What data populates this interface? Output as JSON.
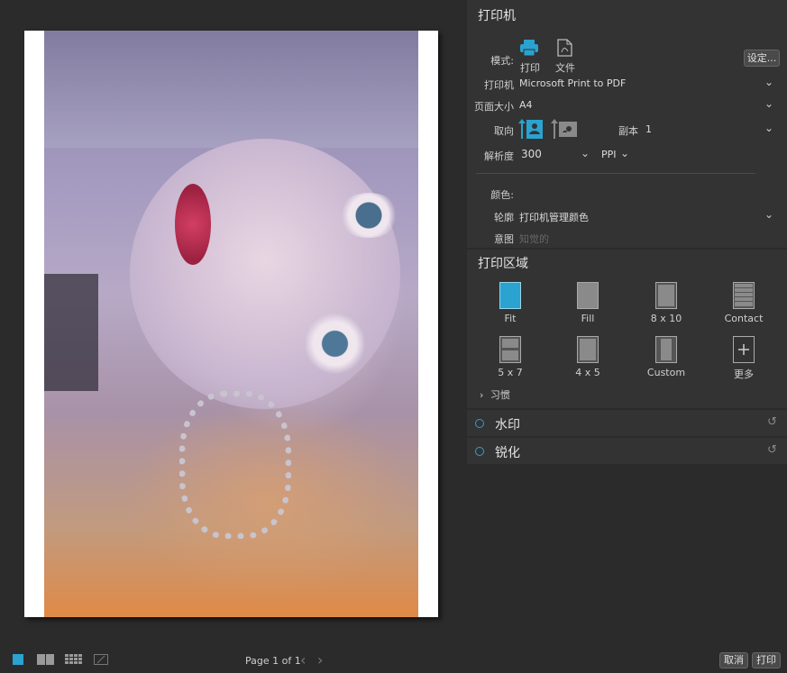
{
  "printer_section": {
    "title": "打印机",
    "mode_label": "模式:",
    "mode_print": "打印",
    "mode_file": "文件",
    "settings_button": "设定...",
    "printer_label": "打印机",
    "printer_value": "Microsoft Print to PDF",
    "page_size_label": "页面大小",
    "page_size_value": "A4",
    "orientation_label": "取向",
    "copies_label": "副本",
    "copies_value": "1",
    "resolution_label": "解析度",
    "resolution_value": "300",
    "resolution_unit": "PPI",
    "color_label": "颜色:",
    "profile_label": "轮廓",
    "profile_value": "打印机管理颜色",
    "intent_label": "意图",
    "intent_value": "知觉的"
  },
  "print_area": {
    "title": "打印区域",
    "tiles": [
      {
        "label": "Fit",
        "icon": "fit-icon"
      },
      {
        "label": "Fill",
        "icon": "fill-icon"
      },
      {
        "label": "8 x 10",
        "icon": "8x10-icon"
      },
      {
        "label": "Contact",
        "icon": "contact-sheet-icon"
      },
      {
        "label": "5 x 7",
        "icon": "5x7-icon"
      },
      {
        "label": "4 x 5",
        "icon": "4x5-icon"
      },
      {
        "label": "Custom",
        "icon": "custom-icon"
      },
      {
        "label": "更多",
        "icon": "plus-icon"
      }
    ],
    "habits_label": "习惯"
  },
  "watermark": {
    "label": "水印"
  },
  "sharpen": {
    "label": "锐化"
  },
  "bottom_bar": {
    "page_label": "Page 1 of 1",
    "cancel": "取消",
    "print": "打印"
  },
  "colors": {
    "accent": "#2aa3d0",
    "panel": "#333333",
    "background": "#2b2b2b"
  }
}
